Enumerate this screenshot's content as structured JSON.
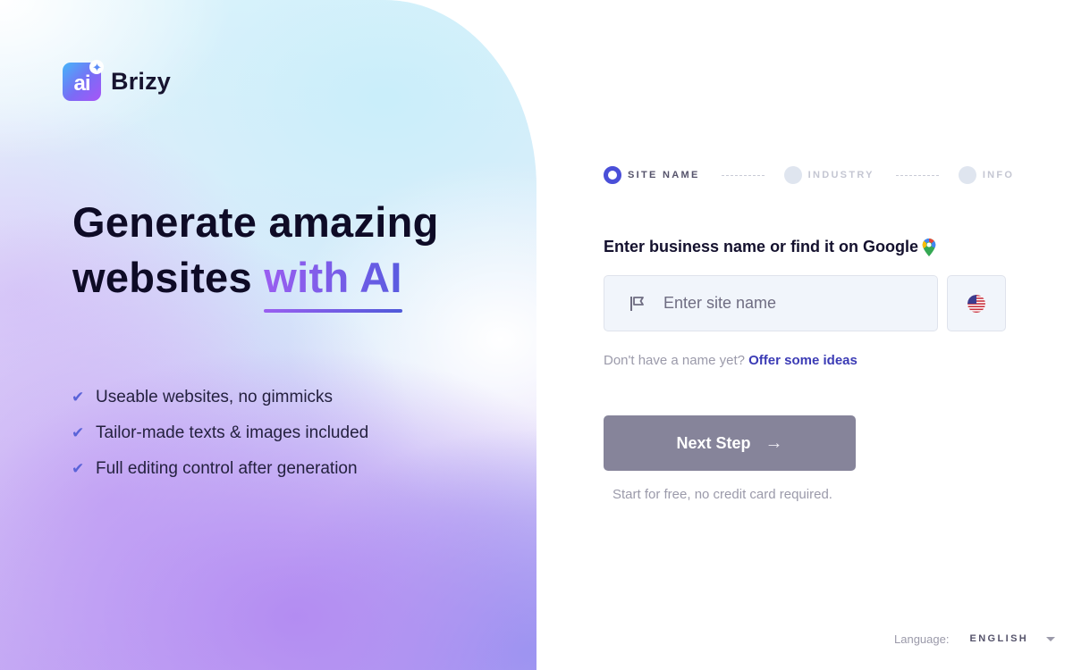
{
  "brand": {
    "logo_mark": "ai",
    "name": "Brizy",
    "logo_icon": "ai-sparkle-icon"
  },
  "hero": {
    "headline_line1": "Generate amazing",
    "headline_line2_plain": "websites ",
    "headline_line2_accent": "with AI",
    "accent_gradient": [
      "#9a5ef0",
      "#4f5ad9"
    ]
  },
  "features": [
    {
      "icon": "check-icon",
      "text": "Useable websites, no gimmicks"
    },
    {
      "icon": "check-icon",
      "text": "Tailor-made texts & images included"
    },
    {
      "icon": "check-icon",
      "text": "Full editing control after generation"
    }
  ],
  "stepper": {
    "steps": [
      {
        "label": "SITE NAME",
        "state": "active"
      },
      {
        "label": "INDUSTRY",
        "state": "inactive"
      },
      {
        "label": "INFO",
        "state": "inactive"
      }
    ],
    "active_color": "#4a4fd8"
  },
  "form": {
    "label": "Enter business name or find it on Google",
    "label_icon": "google-maps-pin-icon",
    "site_name_value": "",
    "site_name_placeholder": "Enter site name",
    "input_icon": "flag-icon",
    "country_icon": "us-flag-icon",
    "hint_text": "Don't have a name yet?",
    "hint_link": "Offer some ideas",
    "next_button": "Next Step",
    "next_button_icon": "arrow-right-icon",
    "subnote": "Start for free, no credit card required."
  },
  "footer": {
    "language_label": "Language:",
    "language_value": "ENGLISH",
    "language_icon": "caret-down-icon"
  }
}
